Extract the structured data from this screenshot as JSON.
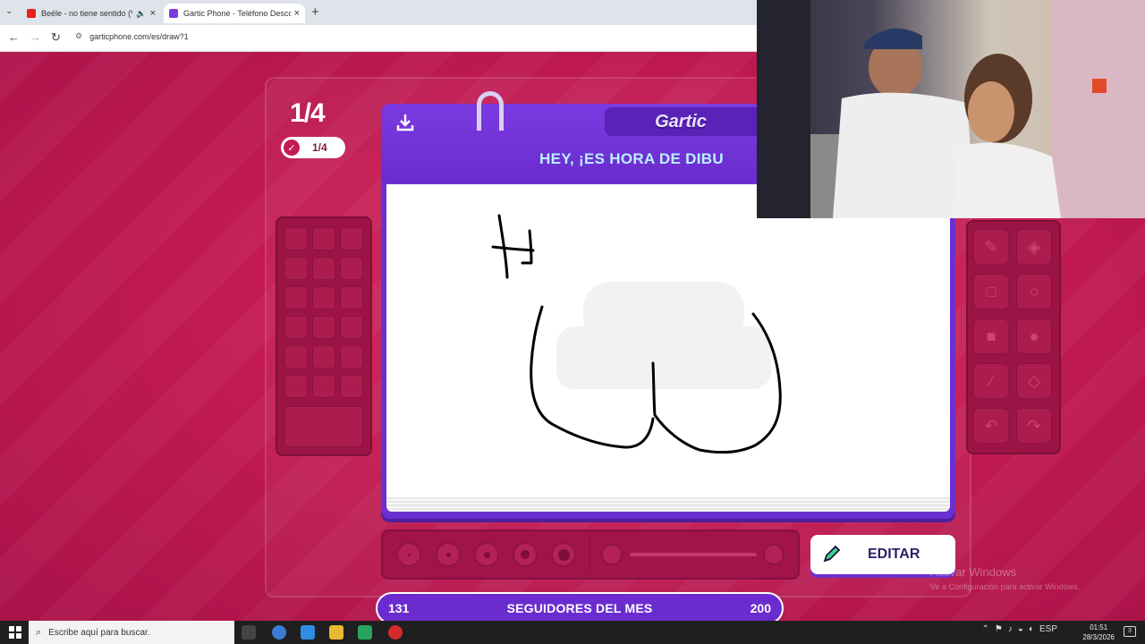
{
  "browser": {
    "tabs": [
      {
        "title": "Beéle - no tiene sentido (Vi",
        "active": false,
        "favicon_color": "#e62117"
      },
      {
        "title": "Gartic Phone - Teléfono Descor",
        "active": true,
        "favicon_color": "#7a3be0"
      }
    ],
    "url": "garticphone.com/es/draw?1"
  },
  "game": {
    "round_big": "1/4",
    "round_pill": "1/4",
    "logo": "Gartic",
    "headline": "HEY, ¡ES HORA DE DIBU",
    "edit_label": "EDITAR",
    "followers": {
      "left": "131",
      "center": "SEGUIDORES DEL MES",
      "right": "200"
    },
    "slider_value": 0.0
  },
  "windows_notice": {
    "line1": "Activar Windows",
    "line2": "Ve a Configuración para activar Windows."
  },
  "taskbar": {
    "search_placeholder": "Escribe aquí para buscar.",
    "lang": "ESP",
    "time": "01:51",
    "date": "28/3/2026",
    "notifications": "3"
  },
  "colors": {
    "bg": "#c21a52",
    "board": "#6c2fd2",
    "accent": "#b8f2ff"
  }
}
